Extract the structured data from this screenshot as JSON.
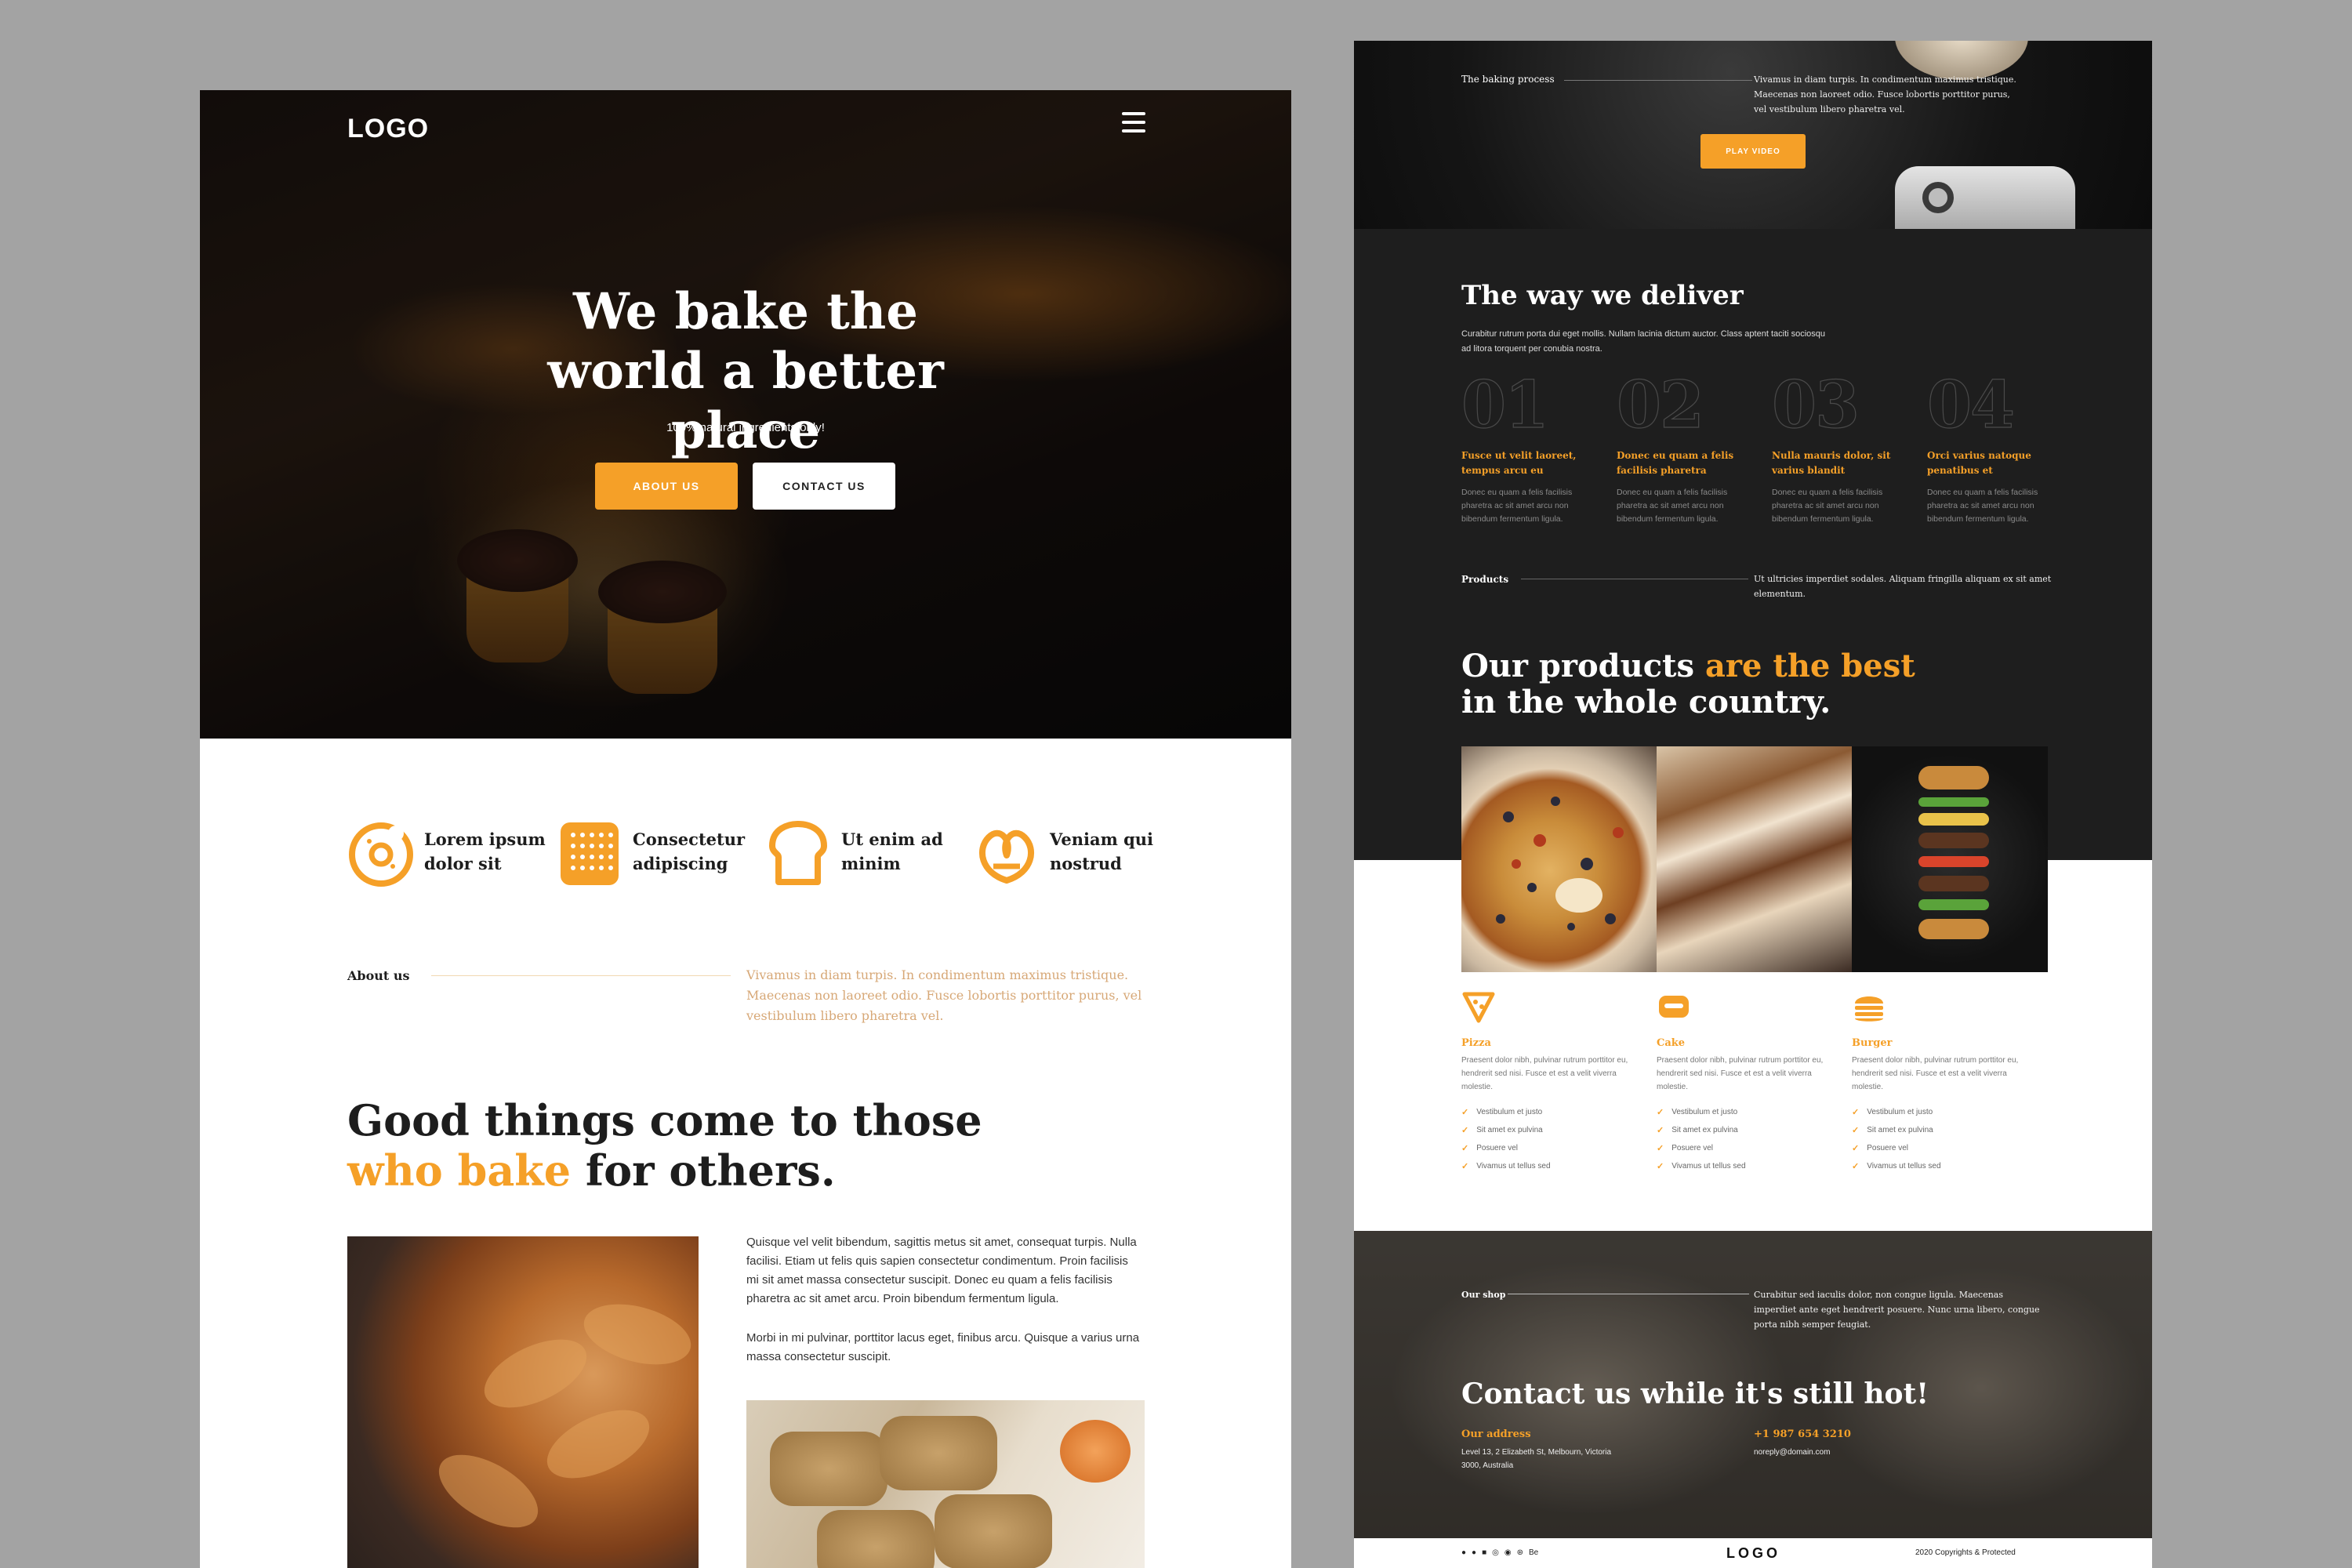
{
  "left_page": {
    "logo": "LOGO",
    "hero": {
      "title": "We bake the world a better place",
      "subtitle": "100% natural ingredients only!",
      "about_button": "ABOUT US",
      "contact_button": "CONTACT US"
    },
    "features": [
      {
        "icon": "donut-icon",
        "label": "Lorem ipsum dolor sit"
      },
      {
        "icon": "biscuit-icon",
        "label": "Consectetur adipiscing"
      },
      {
        "icon": "bread-icon",
        "label": "Ut enim ad minim"
      },
      {
        "icon": "pretzel-icon",
        "label": "Veniam qui nostrud"
      }
    ],
    "about": {
      "label": "About us",
      "text": "Vivamus in diam turpis. In condimentum maximus tristique. Maecenas non laoreet odio. Fusce lobortis porttitor purus, vel vestibulum libero pharetra vel."
    },
    "good_things": {
      "title_part1": "Good things come to those",
      "title_highlight": "who bake",
      "title_part2": "for others."
    },
    "para1": "Quisque vel velit bibendum, sagittis metus sit amet, consequat turpis. Nulla facilisi. Etiam ut felis quis sapien consectetur condimentum. Proin facilisis mi sit amet massa consectetur suscipit. Donec eu quam a felis facilisis pharetra ac sit amet arcu. Proin bibendum fermentum ligula.",
    "para2": "Morbi in mi pulvinar, porttitor lacus eget, finibus arcu. Quisque a varius urna massa consectetur suscipit."
  },
  "right_page": {
    "baking": {
      "label": "The baking process",
      "text": "Vivamus in diam turpis. In condimentum maximus tristique. Maecenas non laoreet odio. Fusce lobortis porttitor purus, vel vestibulum libero pharetra vel.",
      "play_button": "PLAY VIDEO"
    },
    "deliver": {
      "title": "The way we deliver",
      "subtitle": "Curabitur rutrum porta dui eget mollis. Nullam lacinia dictum auctor. Class aptent taciti sociosqu ad litora torquent per conubia nostra.",
      "steps": [
        {
          "num": "01",
          "title": "Fusce ut velit laoreet, tempus arcu eu",
          "desc": "Donec eu quam a felis facilisis pharetra ac sit amet arcu non bibendum fermentum ligula."
        },
        {
          "num": "02",
          "title": "Donec eu quam a felis facilisis pharetra",
          "desc": "Donec eu quam a felis facilisis pharetra ac sit amet arcu non bibendum fermentum ligula."
        },
        {
          "num": "03",
          "title": "Nulla mauris dolor, sit varius blandit",
          "desc": "Donec eu quam a felis facilisis pharetra ac sit amet arcu non bibendum fermentum ligula."
        },
        {
          "num": "04",
          "title": "Orci varius natoque penatibus et",
          "desc": "Donec eu quam a felis facilisis pharetra ac sit amet arcu non bibendum fermentum ligula."
        }
      ]
    },
    "products": {
      "label": "Products",
      "text": "Ut ultricies imperdiet sodales. Aliquam fringilla aliquam ex sit amet elementum.",
      "title_part1": "Our products",
      "title_highlight": "are the best",
      "title_part2": "in the whole country.",
      "items": [
        {
          "icon": "pizza-icon",
          "name": "Pizza",
          "desc": "Praesent dolor nibh, pulvinar rutrum porttitor eu, hendrerit sed nisi. Fusce et est a velit viverra molestie.",
          "bullets": [
            "Vestibulum et justo",
            "Sit amet ex pulvina",
            "Posuere vel",
            "Vivamus ut tellus sed"
          ]
        },
        {
          "icon": "cake-icon",
          "name": "Cake",
          "desc": "Praesent dolor nibh, pulvinar rutrum porttitor eu, hendrerit sed nisi. Fusce et est a velit viverra molestie.",
          "bullets": [
            "Vestibulum et justo",
            "Sit amet ex pulvina",
            "Posuere vel",
            "Vivamus ut tellus sed"
          ]
        },
        {
          "icon": "burger-icon",
          "name": "Burger",
          "desc": "Praesent dolor nibh, pulvinar rutrum porttitor eu, hendrerit sed nisi. Fusce et est a velit viverra molestie.",
          "bullets": [
            "Vestibulum et justo",
            "Sit amet ex pulvina",
            "Posuere vel",
            "Vivamus ut tellus sed"
          ]
        }
      ]
    },
    "shop": {
      "label": "Our shop",
      "text": "Curabitur sed iaculis dolor, non congue ligula. Maecenas imperdiet ante eget hendrerit posuere. Nunc urna libero, congue porta nibh semper feugiat."
    },
    "contact": {
      "title": "Contact us while it's still hot!",
      "address_label": "Our address",
      "address": "Level 13, 2 Elizabeth St, Melbourn, Victoria 3000, Australia",
      "phone": "+1 987 654 3210",
      "email": "noreply@domain.com"
    },
    "footer": {
      "socials": [
        "facebook-icon",
        "twitter-icon",
        "youtube-icon",
        "instagram-icon",
        "pinterest-icon",
        "dribbble-icon",
        "behance-icon"
      ],
      "behance_text": "Be",
      "logo": "LOGO",
      "copyright": "2020 Copyrights & Protected"
    }
  },
  "colors": {
    "accent": "#f5a028",
    "dark": "#1e1e1e",
    "backdrop": "#a3a3a3"
  }
}
